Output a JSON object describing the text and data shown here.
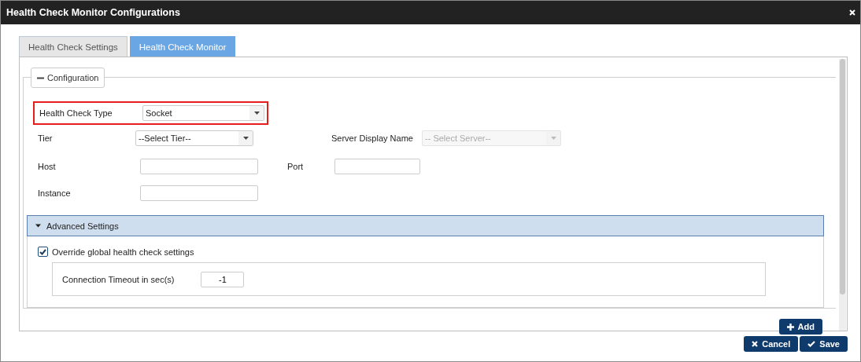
{
  "window": {
    "title": "Health Check Monitor Configurations"
  },
  "tabs": [
    {
      "label": "Health Check Settings",
      "selected": false
    },
    {
      "label": "Health Check Monitor",
      "selected": true
    }
  ],
  "configuration": {
    "legend": "Configuration",
    "expanded": true,
    "rows": [
      [
        {
          "kind": "select",
          "label": "Health Check Type",
          "value": "Socket",
          "highlighted": true,
          "disabled": false
        }
      ],
      [
        {
          "kind": "select",
          "label": "Tier",
          "value": "--Select Tier--",
          "highlighted": false,
          "disabled": false
        },
        {
          "kind": "select",
          "label": "Server Display Name",
          "value": "-- Select Server--",
          "highlighted": false,
          "disabled": true
        }
      ],
      [
        {
          "kind": "input",
          "label": "Host",
          "highlighted": false,
          "disabled": false
        },
        {
          "kind": "input",
          "label": "Port",
          "highlighted": false,
          "disabled": false
        }
      ],
      [
        {
          "kind": "input",
          "label": "Instance",
          "highlighted": false,
          "disabled": false
        }
      ]
    ],
    "advanced": {
      "title": "Advanced Settings",
      "expanded": true,
      "override": {
        "label": "Override global health check settings",
        "checked": true
      },
      "timeout": {
        "label": "Connection Timeout in sec(s)",
        "value": "-1"
      }
    }
  },
  "add_button": "Add",
  "buttons": [
    {
      "kind": "cancel",
      "label": "Cancel"
    },
    {
      "kind": "save",
      "label": "Save"
    }
  ]
}
